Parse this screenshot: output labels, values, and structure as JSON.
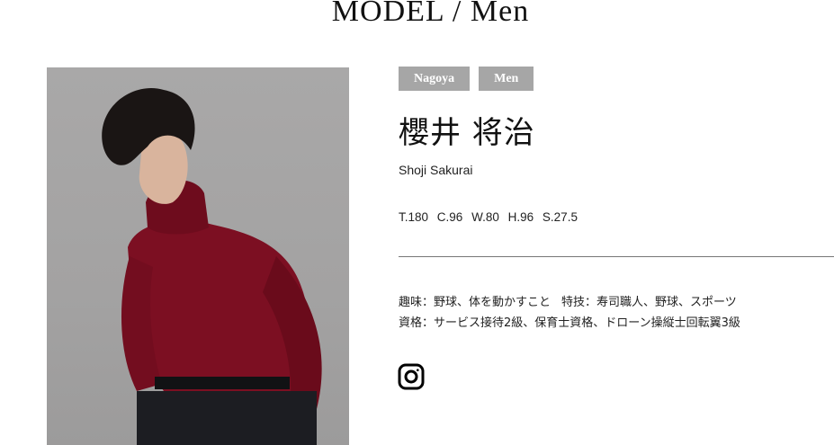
{
  "header": {
    "title_left": "MODEL",
    "title_sep": "/",
    "title_right": "Men"
  },
  "tags": [
    "Nagoya",
    "Men"
  ],
  "model": {
    "name_jp": "櫻井 将治",
    "name_en": "Shoji Sakurai",
    "measurements": [
      "T.180",
      "C.96",
      "W.80",
      "H.96",
      "S.27.5"
    ],
    "hobby_label": "趣味：",
    "hobby": "野球、体を動かすこと",
    "skill_label": "特技：",
    "skill": "寿司職人、野球、スポーツ",
    "qual_label": "資格：",
    "qual": "サービス接待2級、保育士資格、ドローン操縦士回転翼3級"
  },
  "social": {
    "icon": "instagram-icon"
  },
  "colors": {
    "tag_bg": "#a6a6a6",
    "photo_bg": "#a3a2a2",
    "sweater": "#7c0f22"
  }
}
